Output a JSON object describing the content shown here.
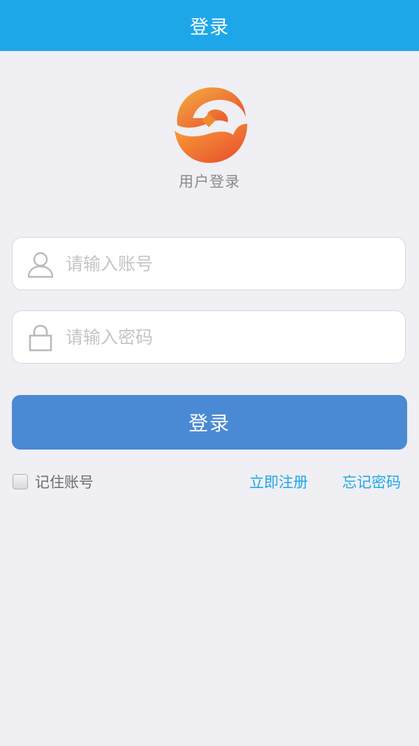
{
  "header": {
    "title": "登录"
  },
  "logo": {
    "caption": "用户登录",
    "icon": "coin-hands-logo"
  },
  "form": {
    "account_placeholder": "请输入账号",
    "account_value": "",
    "account_icon": "user-icon",
    "password_placeholder": "请输入密码",
    "password_value": "",
    "password_icon": "lock-icon",
    "login_label": "登录"
  },
  "options": {
    "remember_label": "记住账号",
    "remember_checked": false,
    "register_label": "立即注册",
    "forgot_label": "忘记密码"
  },
  "colors": {
    "header_bg": "#1ea7e8",
    "button_bg": "#4a8ad4",
    "link": "#1ea7e8",
    "page_bg": "#efeff4"
  }
}
